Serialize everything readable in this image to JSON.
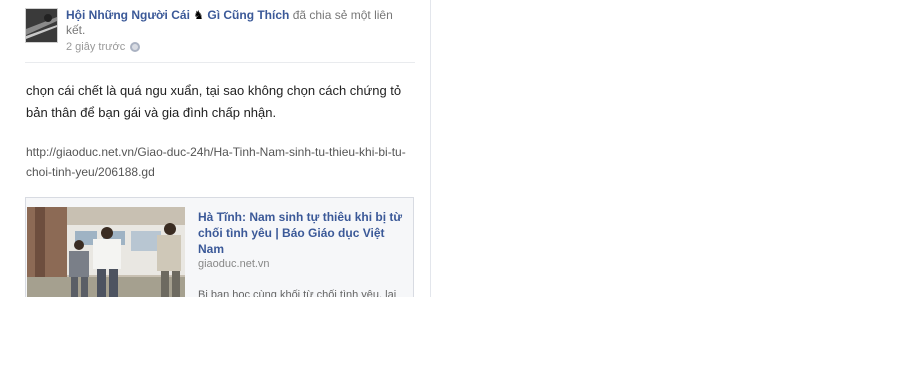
{
  "post": {
    "page_name_before": "Hội Những Người Cái",
    "page_name_glyph": "♞",
    "page_name_after": "Gì Cũng Thích",
    "shared_text": "đã chia sẻ một liên kết.",
    "timestamp": "2 giây trước",
    "privacy_icon": "globe-icon",
    "message": "chọn cái chết là quá ngu xuẩn, tại sao không chọn cách chứng tỏ bản thân để bạn gái và gia đình chấp nhận.",
    "link_url": "http://giaoduc.net.vn/Giao-duc-24h/Ha-Tinh-Nam-sinh-tu-thieu-khi-bi-tu-choi-tinh-yeu/206188.gd"
  },
  "attachment": {
    "title": "Hà Tĩnh: Nam sinh tự thiêu khi bị từ chối tình yêu | Báo Giáo dục Việt Nam",
    "domain": "giaoduc.net.vn",
    "description": "Bị bạn học cùng khối từ chối tình yêu, lại"
  },
  "colors": {
    "link_blue": "#3b5998",
    "meta_gray": "#777777",
    "border": "#d8dbe2"
  }
}
